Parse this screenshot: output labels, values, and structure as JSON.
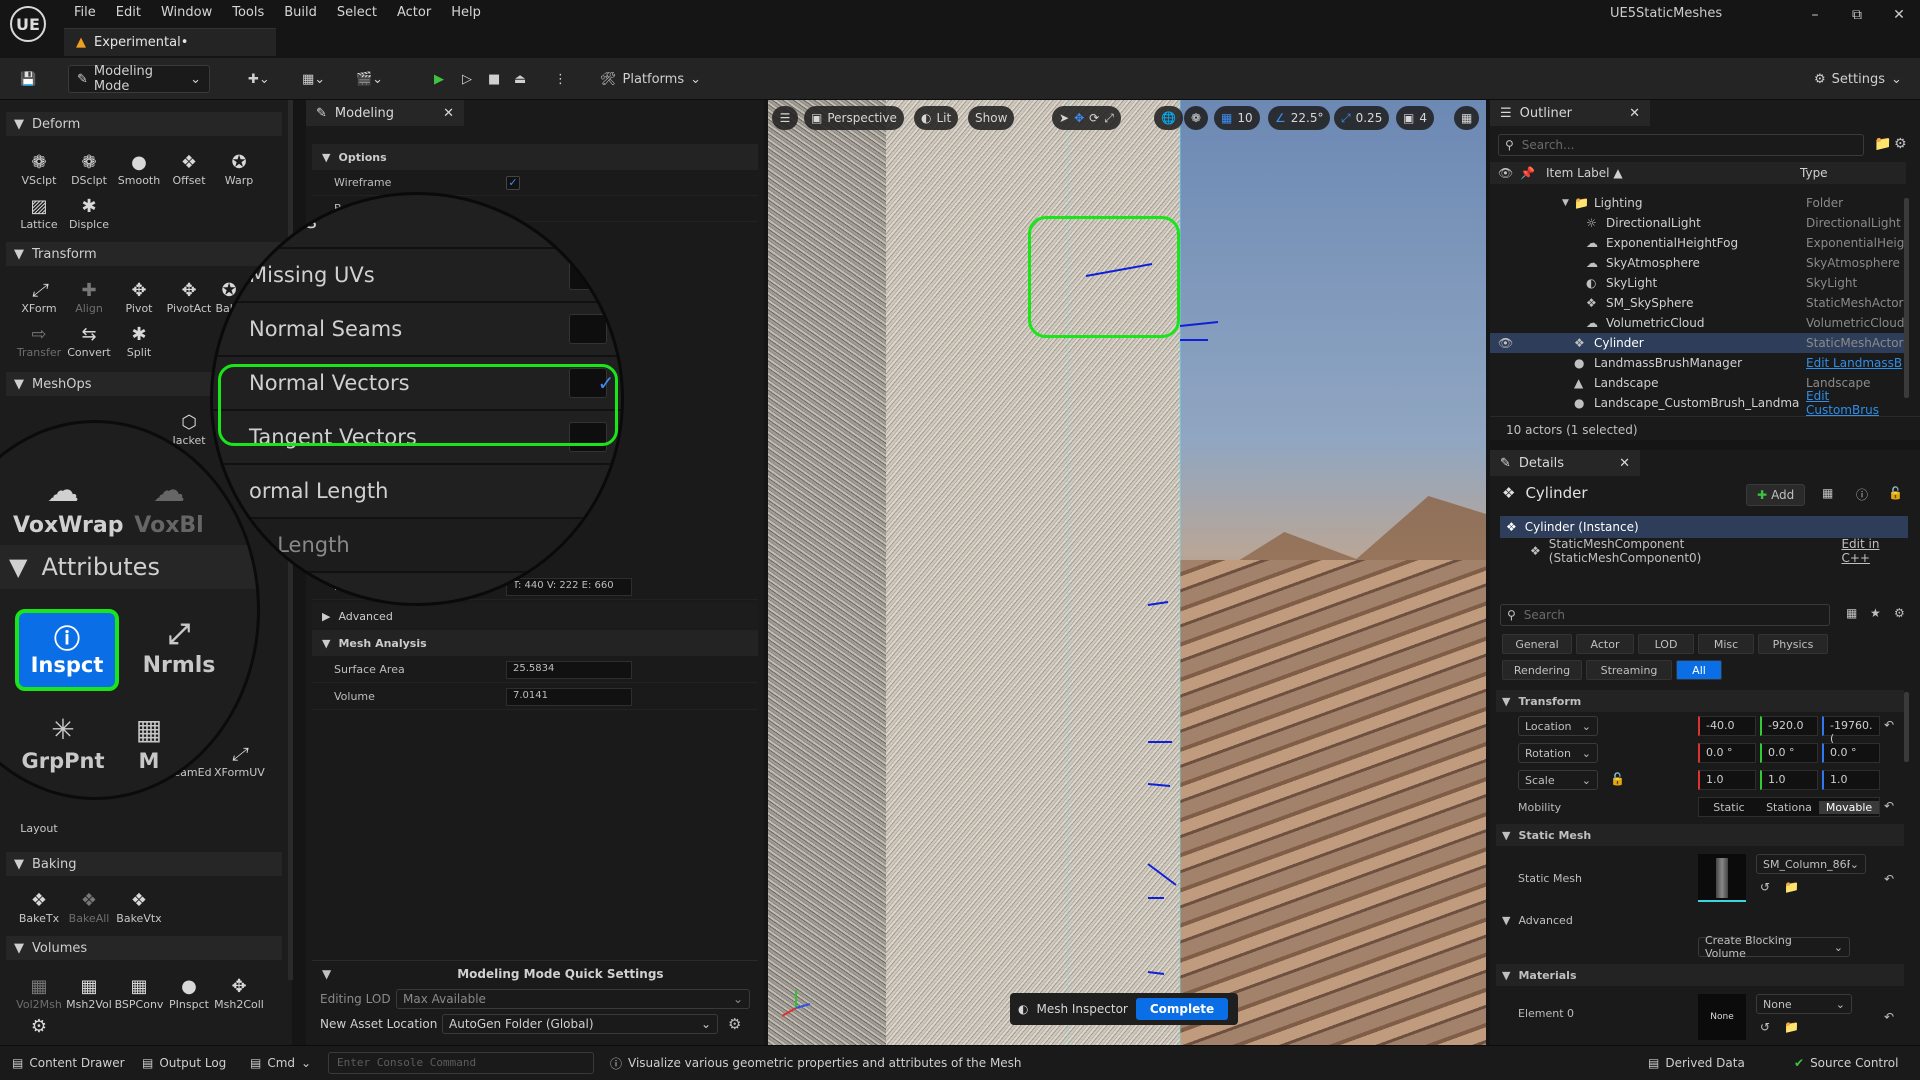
{
  "app": {
    "logo": "UE",
    "menu": [
      "File",
      "Edit",
      "Window",
      "Tools",
      "Build",
      "Select",
      "Actor",
      "Help"
    ],
    "map_tab": "Experimental•",
    "project": "UE5StaticMeshes",
    "window_controls": [
      "–",
      "⧉",
      "✕"
    ]
  },
  "toolbar": {
    "mode": "Modeling Mode",
    "platforms": "Platforms",
    "settings": "Settings"
  },
  "left_panel": {
    "sections": [
      {
        "title": "Deform",
        "tools": [
          "VSclpt",
          "DSclpt",
          "Smooth",
          "Offset",
          "Warp",
          "Lattice",
          "Displce"
        ]
      },
      {
        "title": "Transform",
        "tools": [
          "XForm",
          "Align",
          "Pivot",
          "PivotAct",
          "Bake",
          "Transfer",
          "Convert",
          "Split"
        ]
      },
      {
        "title": "MeshOps",
        "tools": [
          "Jacket"
        ]
      },
      {
        "title": "Baking",
        "tools": [
          "BakeTx",
          "BakeAll",
          "BakeVtx"
        ]
      },
      {
        "title": "Volumes",
        "tools": [
          "Vol2Msh",
          "Msh2Vol",
          "BSPConv",
          "PInspct",
          "Msh2Coll"
        ]
      }
    ],
    "partial_tools": [
      "SeamEd",
      "XFormUV",
      "Layout"
    ]
  },
  "zoom_left": {
    "tools_top": [
      "VoxWrap",
      "VoxBl"
    ],
    "section": "Attributes",
    "selected_tool": "Inspct",
    "other_tool": "Nrmls",
    "bottom_tools": [
      "GrpPnt",
      "M"
    ]
  },
  "modeling_panel": {
    "tab": "Modeling",
    "options_header": "Options",
    "wireframe_label": "Wireframe",
    "wireframe_checked": true,
    "partial_label": "Bo",
    "mesh_label": "Mesh",
    "mesh_value": "T: 440  V: 222  E: 660",
    "advanced": "Advanced",
    "mesh_analysis": "Mesh Analysis",
    "surface_area_label": "Surface Area",
    "surface_area": "25.5834",
    "volume_label": "Volume",
    "volume": "7.0141",
    "quick_settings": "Modeling Mode Quick Settings",
    "editing_lod_label": "Editing LOD",
    "editing_lod": "Max Available",
    "new_asset_label": "New Asset Location",
    "new_asset": "AutoGen Folder (Global)"
  },
  "zoom_panel": {
    "rows": [
      {
        "label": "owties",
        "checked": false
      },
      {
        "label": "Missing UVs",
        "checked": false
      },
      {
        "label": "Normal Seams",
        "checked": false
      },
      {
        "label": "Normal Vectors",
        "checked": true
      },
      {
        "label": "Tangent Vectors",
        "checked": false
      },
      {
        "label": "ormal Length",
        "checked": false
      },
      {
        "label": "nt Length",
        "checked": false
      }
    ]
  },
  "viewport": {
    "perspective": "Perspective",
    "lit": "Lit",
    "show": "Show",
    "grid": "10",
    "angle": "22.5°",
    "scale": "0.25",
    "camera": "4",
    "inspector": "Mesh Inspector",
    "complete": "Complete"
  },
  "outliner": {
    "tab": "Outliner",
    "search_placeholder": "Search...",
    "col_label": "Item Label ▲",
    "col_type": "Type",
    "rows": [
      {
        "name": "Lighting",
        "type": "Folder",
        "indent": 1,
        "icon": "folder-icon"
      },
      {
        "name": "DirectionalLight",
        "type": "DirectionalLight",
        "indent": 2,
        "icon": "sun-icon"
      },
      {
        "name": "ExponentialHeightFog",
        "type": "ExponentialHeigl",
        "indent": 2,
        "icon": "fog-icon"
      },
      {
        "name": "SkyAtmosphere",
        "type": "SkyAtmosphere",
        "indent": 2,
        "icon": "sky-icon"
      },
      {
        "name": "SkyLight",
        "type": "SkyLight",
        "indent": 2,
        "icon": "light-icon"
      },
      {
        "name": "SM_SkySphere",
        "type": "StaticMeshActor",
        "indent": 2,
        "icon": "mesh-icon"
      },
      {
        "name": "VolumetricCloud",
        "type": "VolumetricCloud",
        "indent": 2,
        "icon": "cloud-icon"
      },
      {
        "name": "Cylinder",
        "type": "StaticMeshActor",
        "indent": 1,
        "icon": "mesh-icon",
        "selected": true
      },
      {
        "name": "LandmassBrushManager",
        "type": "Edit LandmassB",
        "indent": 1,
        "icon": "actor-icon",
        "link": true
      },
      {
        "name": "Landscape",
        "type": "Landscape",
        "indent": 1,
        "icon": "landscape-icon"
      },
      {
        "name": "Landscape_CustomBrush_Landma",
        "type": "Edit CustomBrus",
        "indent": 1,
        "icon": "actor-icon",
        "link": true
      }
    ],
    "footer": "10 actors (1 selected)"
  },
  "details": {
    "tab": "Details",
    "actor": "Cylinder",
    "add": "Add",
    "instance": "Cylinder (Instance)",
    "component": "StaticMeshComponent (StaticMeshComponent0)",
    "edit_cpp": "Edit in C++",
    "search_placeholder": "Search",
    "filters_row1": [
      "General",
      "Actor",
      "LOD",
      "Misc",
      "Physics"
    ],
    "filters_row2": [
      "Rendering",
      "Streaming",
      "All"
    ],
    "transform": "Transform",
    "location_label": "Location",
    "location": [
      "-40.0",
      "-920.0",
      "-19760.("
    ],
    "rotation_label": "Rotation",
    "rotation": [
      "0.0 °",
      "0.0 °",
      "0.0 °"
    ],
    "scale_label": "Scale",
    "scale": [
      "1.0",
      "1.0",
      "1.0"
    ],
    "mobility_label": "Mobility",
    "mobility": [
      "Static",
      "Stationa",
      "Movable"
    ],
    "static_mesh_section": "Static Mesh",
    "static_mesh_label": "Static Mesh",
    "static_mesh_value": "SM_Column_86F",
    "advanced": "Advanced",
    "blocking_volume": "Create Blocking Volume",
    "materials": "Materials",
    "element0_label": "Element 0",
    "element0_value": "None",
    "material_thumb": "None"
  },
  "statusbar": {
    "content_drawer": "Content Drawer",
    "output_log": "Output Log",
    "cmd": "Cmd",
    "console_placeholder": "Enter Console Command",
    "hint": "Visualize various geometric properties and attributes of the Mesh",
    "derived_data": "Derived Data",
    "source_control": "Source Control"
  },
  "colors": {
    "accent": "#0a6fe6",
    "highlight": "#19e519",
    "link": "#2f8ee8"
  }
}
